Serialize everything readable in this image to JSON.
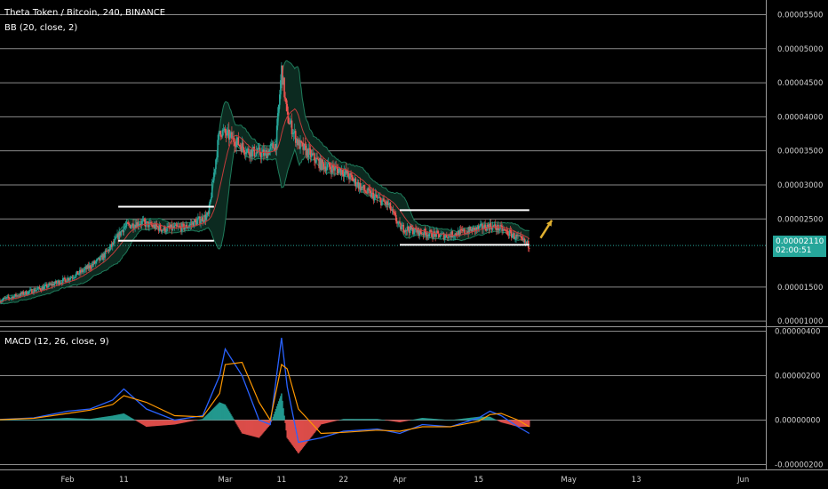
{
  "header": {
    "title": "Theta Token / Bitcoin, 240, BINANCE",
    "bb_label": "BB (20, close, 2)",
    "macd_label": "MACD (12, 26, close, 9)"
  },
  "price_tag": {
    "value": "0.00002110",
    "countdown": "02:00:51",
    "color": "#26a69a"
  },
  "colors": {
    "background": "#000000",
    "grid": "#8a8a8a",
    "up_candle": "#26a69a",
    "down_candle": "#ef5350",
    "bb_band": "#1e7a5a",
    "bb_basis": "#c43b3b",
    "macd_line": "#2962ff",
    "signal_line": "#ff9800",
    "arrow": "#e0b030",
    "range_lines": "#ffffff"
  },
  "chart_data": [
    {
      "type": "line",
      "title": "Theta Token / Bitcoin, 240, BINANCE",
      "subtitle": "BB (20, close, 2)",
      "y_ticks": [
        "0.00005500",
        "0.00005000",
        "0.00004500",
        "0.00004000",
        "0.00003500",
        "0.00003000",
        "0.00002500",
        "0.00001500",
        "0.00001000"
      ],
      "y_tick_values": [
        5.5e-05,
        5e-05,
        4.5e-05,
        4e-05,
        3.5e-05,
        3e-05,
        2.5e-05,
        1.5e-05,
        1e-05
      ],
      "ylim": [
        9.5e-06,
        5.65e-05
      ],
      "x_tick_labels": [
        "Feb",
        "11",
        "Mar",
        "11",
        "22",
        "Apr",
        "15",
        "May",
        "13",
        "Jun"
      ],
      "x_tick_dates": [
        "2019-02-01",
        "2019-02-11",
        "2019-03-01",
        "2019-03-11",
        "2019-03-22",
        "2019-04-01",
        "2019-04-15",
        "2019-05-01",
        "2019-05-13",
        "2019-06-01"
      ],
      "xlim": [
        "2019-01-20",
        "2019-06-05"
      ],
      "last_price": 2.11e-05,
      "close_series": [
        {
          "date": "2019-01-20",
          "v": 1.3e-05
        },
        {
          "date": "2019-01-24",
          "v": 1.4e-05
        },
        {
          "date": "2019-01-28",
          "v": 1.5e-05
        },
        {
          "date": "2019-02-01",
          "v": 1.62e-05
        },
        {
          "date": "2019-02-04",
          "v": 1.75e-05
        },
        {
          "date": "2019-02-07",
          "v": 1.92e-05
        },
        {
          "date": "2019-02-09",
          "v": 2.12e-05
        },
        {
          "date": "2019-02-11",
          "v": 2.38e-05
        },
        {
          "date": "2019-02-14",
          "v": 2.45e-05
        },
        {
          "date": "2019-02-18",
          "v": 2.35e-05
        },
        {
          "date": "2019-02-22",
          "v": 2.38e-05
        },
        {
          "date": "2019-02-26",
          "v": 2.55e-05
        },
        {
          "date": "2019-02-28",
          "v": 3.8e-05
        },
        {
          "date": "2019-03-02",
          "v": 3.7e-05
        },
        {
          "date": "2019-03-05",
          "v": 3.5e-05
        },
        {
          "date": "2019-03-08",
          "v": 3.45e-05
        },
        {
          "date": "2019-03-10",
          "v": 3.6e-05
        },
        {
          "date": "2019-03-11",
          "v": 4.7e-05
        },
        {
          "date": "2019-03-12",
          "v": 4e-05
        },
        {
          "date": "2019-03-14",
          "v": 3.6e-05
        },
        {
          "date": "2019-03-18",
          "v": 3.3e-05
        },
        {
          "date": "2019-03-22",
          "v": 3.2e-05
        },
        {
          "date": "2019-03-26",
          "v": 2.9e-05
        },
        {
          "date": "2019-03-30",
          "v": 2.7e-05
        },
        {
          "date": "2019-04-01",
          "v": 2.38e-05
        },
        {
          "date": "2019-04-05",
          "v": 2.3e-05
        },
        {
          "date": "2019-04-09",
          "v": 2.25e-05
        },
        {
          "date": "2019-04-13",
          "v": 2.32e-05
        },
        {
          "date": "2019-04-17",
          "v": 2.4e-05
        },
        {
          "date": "2019-04-19",
          "v": 2.35e-05
        },
        {
          "date": "2019-04-22",
          "v": 2.22e-05
        },
        {
          "date": "2019-04-24",
          "v": 2.11e-05
        }
      ]
    },
    {
      "type": "line",
      "title": "MACD (12, 26, close, 9)",
      "y_ticks": [
        "0.00000400",
        "0.00000200",
        "0.00000000",
        "-0.00000200"
      ],
      "y_tick_values": [
        4e-06,
        2e-06,
        0,
        -2e-06
      ],
      "ylim": [
        -2.1e-06,
        4.1e-06
      ],
      "series": [
        {
          "points": [
            {
              "date": "2019-01-20",
              "v": 3e-08
            },
            {
              "date": "2019-01-26",
              "v": 1e-07
            },
            {
              "date": "2019-02-01",
              "v": 4e-07
            },
            {
              "date": "2019-02-05",
              "v": 5e-07
            },
            {
              "date": "2019-02-09",
              "v": 9e-07
            },
            {
              "date": "2019-02-11",
              "v": 1.4e-06
            },
            {
              "date": "2019-02-15",
              "v": 5e-07
            },
            {
              "date": "2019-02-20",
              "v": 0.0
            },
            {
              "date": "2019-02-25",
              "v": 2e-07
            },
            {
              "date": "2019-02-28",
              "v": 2e-06
            },
            {
              "date": "2019-03-01",
              "v": 3.2e-06
            },
            {
              "date": "2019-03-04",
              "v": 2e-06
            },
            {
              "date": "2019-03-07",
              "v": 0.0
            },
            {
              "date": "2019-03-09",
              "v": -2e-07
            },
            {
              "date": "2019-03-11",
              "v": 3.7e-06
            },
            {
              "date": "2019-03-12",
              "v": 1.5e-06
            },
            {
              "date": "2019-03-14",
              "v": -1e-06
            },
            {
              "date": "2019-03-18",
              "v": -8e-07
            },
            {
              "date": "2019-03-22",
              "v": -5e-07
            },
            {
              "date": "2019-03-28",
              "v": -4e-07
            },
            {
              "date": "2019-04-01",
              "v": -6e-07
            },
            {
              "date": "2019-04-05",
              "v": -2e-07
            },
            {
              "date": "2019-04-10",
              "v": -3e-07
            },
            {
              "date": "2019-04-15",
              "v": 1e-07
            },
            {
              "date": "2019-04-17",
              "v": 4e-07
            },
            {
              "date": "2019-04-19",
              "v": 2e-07
            },
            {
              "date": "2019-04-22",
              "v": -3e-07
            },
            {
              "date": "2019-04-24",
              "v": -6e-07
            }
          ]
        },
        {
          "points": [
            {
              "date": "2019-01-20",
              "v": 2e-08
            },
            {
              "date": "2019-01-26",
              "v": 8e-08
            },
            {
              "date": "2019-02-01",
              "v": 3e-07
            },
            {
              "date": "2019-02-05",
              "v": 4.5e-07
            },
            {
              "date": "2019-02-09",
              "v": 7e-07
            },
            {
              "date": "2019-02-11",
              "v": 1.1e-06
            },
            {
              "date": "2019-02-15",
              "v": 8e-07
            },
            {
              "date": "2019-02-20",
              "v": 2e-07
            },
            {
              "date": "2019-02-25",
              "v": 1.5e-07
            },
            {
              "date": "2019-02-28",
              "v": 1.2e-06
            },
            {
              "date": "2019-03-01",
              "v": 2.5e-06
            },
            {
              "date": "2019-03-04",
              "v": 2.6e-06
            },
            {
              "date": "2019-03-07",
              "v": 8e-07
            },
            {
              "date": "2019-03-09",
              "v": 0.0
            },
            {
              "date": "2019-03-11",
              "v": 2.5e-06
            },
            {
              "date": "2019-03-12",
              "v": 2.3e-06
            },
            {
              "date": "2019-03-14",
              "v": 5e-07
            },
            {
              "date": "2019-03-18",
              "v": -6e-07
            },
            {
              "date": "2019-03-22",
              "v": -5.5e-07
            },
            {
              "date": "2019-03-28",
              "v": -4.5e-07
            },
            {
              "date": "2019-04-01",
              "v": -5e-07
            },
            {
              "date": "2019-04-05",
              "v": -3e-07
            },
            {
              "date": "2019-04-10",
              "v": -3e-07
            },
            {
              "date": "2019-04-15",
              "v": -5e-08
            },
            {
              "date": "2019-04-17",
              "v": 2.5e-07
            },
            {
              "date": "2019-04-19",
              "v": 3e-07
            },
            {
              "date": "2019-04-22",
              "v": 0.0
            },
            {
              "date": "2019-04-24",
              "v": -3e-07
            }
          ]
        }
      ]
    }
  ],
  "annotations": {
    "range_1": {
      "start": "2019-02-10",
      "end": "2019-02-27",
      "top": 2.68e-05,
      "bottom": 2.18e-05
    },
    "range_2": {
      "start": "2019-04-01",
      "end": "2019-04-24",
      "top": 2.63e-05,
      "bottom": 2.12e-05
    },
    "arrow": {
      "from_date": "2019-04-26",
      "from_v": 2.22e-05,
      "to_date": "2019-04-28",
      "to_v": 2.48e-05
    }
  }
}
